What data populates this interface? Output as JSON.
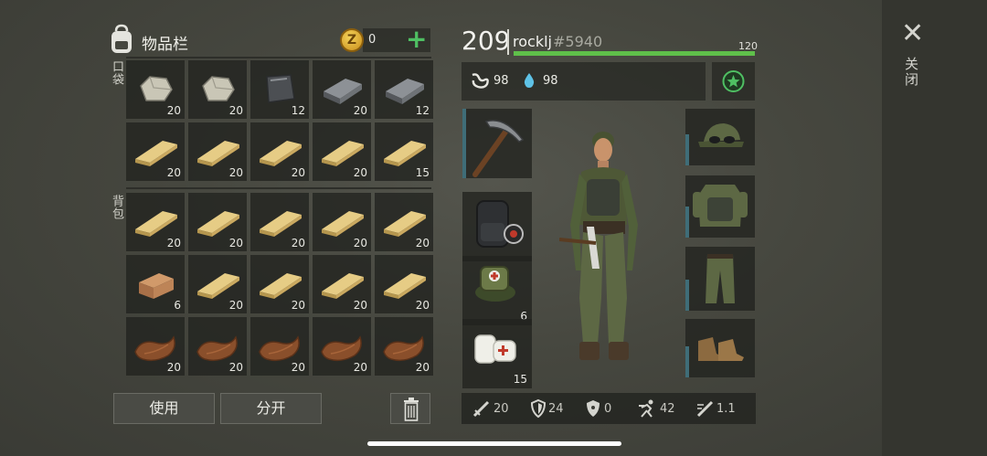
{
  "inventory": {
    "title": "物品栏",
    "coins": "0",
    "pocket_label": "口袋",
    "backpack_label": "背包",
    "pocket_slots": [
      {
        "item": "stone",
        "count": "20"
      },
      {
        "item": "stone",
        "count": "20"
      },
      {
        "item": "iron-ore",
        "count": "12"
      },
      {
        "item": "iron-ingot",
        "count": "20"
      },
      {
        "item": "iron-ingot",
        "count": "12"
      },
      {
        "item": "plank",
        "count": "20"
      },
      {
        "item": "plank",
        "count": "20"
      },
      {
        "item": "plank",
        "count": "20"
      },
      {
        "item": "plank",
        "count": "20"
      },
      {
        "item": "plank",
        "count": "15"
      }
    ],
    "backpack_slots": [
      {
        "item": "plank",
        "count": "20"
      },
      {
        "item": "plank",
        "count": "20"
      },
      {
        "item": "plank",
        "count": "20"
      },
      {
        "item": "plank",
        "count": "20"
      },
      {
        "item": "plank",
        "count": "20"
      },
      {
        "item": "log",
        "count": "6"
      },
      {
        "item": "plank",
        "count": "20"
      },
      {
        "item": "plank",
        "count": "20"
      },
      {
        "item": "plank",
        "count": "20"
      },
      {
        "item": "plank",
        "count": "20"
      },
      {
        "item": "leather",
        "count": "20"
      },
      {
        "item": "leather",
        "count": "20"
      },
      {
        "item": "leather",
        "count": "20"
      },
      {
        "item": "leather",
        "count": "20"
      },
      {
        "item": "leather",
        "count": "20"
      }
    ],
    "use_label": "使用",
    "split_label": "分开"
  },
  "player": {
    "level": "209",
    "username": "rocklj",
    "user_id": "#5940",
    "health": "120",
    "health_fraction": 1.0,
    "food": "98",
    "water": "98"
  },
  "equipment": {
    "hand": {
      "item": "pickaxe",
      "count": ""
    },
    "bag": {
      "item": "backpack",
      "count": ""
    },
    "kit": {
      "item": "first-aid-bag",
      "count": "6"
    },
    "bandage": {
      "item": "bandage",
      "count": "15"
    },
    "gear": [
      "camo-cap",
      "camo-vest",
      "camo-pants",
      "boots"
    ]
  },
  "combat_stats": {
    "attack": "20",
    "defense": "24",
    "radiation": "0",
    "speed": "42",
    "crit": "1.1"
  },
  "close_label": "关闭",
  "colors": {
    "health": "#5fc04a",
    "plus": "#4fbf63",
    "coin": "#e6b634",
    "star": "#4fbf63"
  }
}
